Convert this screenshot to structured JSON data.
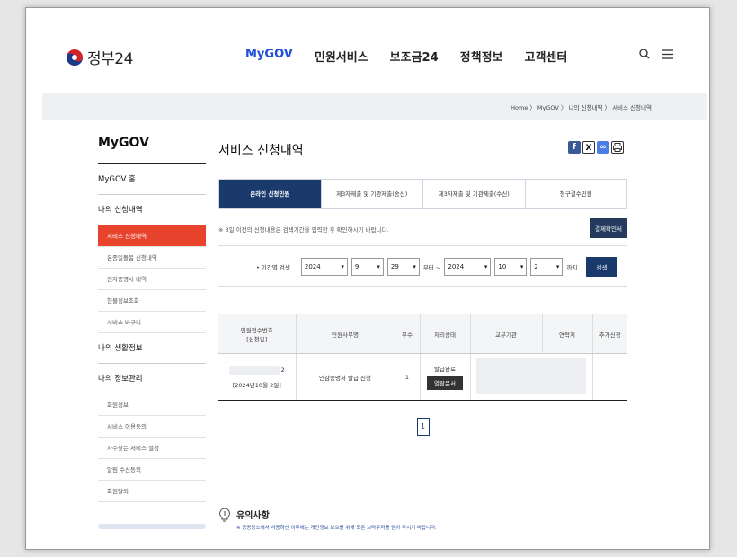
{
  "header": {
    "logo_text": "정부24",
    "nav": [
      "MyGOV",
      "민원서비스",
      "보조금24",
      "정책정보",
      "고객센터"
    ],
    "active_nav": "MyGOV"
  },
  "breadcrumb": "Home 〉 MyGOV 〉 나의 신청내역 〉 서비스 신청내역",
  "sidebar": {
    "title": "MyGOV",
    "home": "MyGOV 홈",
    "section1": "나의 신청내역",
    "sub1": [
      "서비스 신청내역",
      "온종일돌봄 신청내역",
      "전자증명서 내역",
      "현물정보조회",
      "서비스 바구니"
    ],
    "section2": "나의 생활정보",
    "section3": "나의 정보관리",
    "sub3": [
      "회원정보",
      "서비스 이용동의",
      "자주찾는 서비스 설정",
      "알림 수신동의",
      "회원탈퇴"
    ]
  },
  "page": {
    "title": "서비스 신청내역",
    "tabs": [
      "온라인 신청민원",
      "제3자제출 및 기관제출(송신)",
      "제3자제출 및 기관제출(수신)",
      "청구결수민원"
    ],
    "notice": "※ 3일 이전의 신청내용은 검색기간을 입력한 후 확인하시기 바랍니다.",
    "payment_button": "결제확인서",
    "search": {
      "label": "• 기간별 검색",
      "from_year": "2024",
      "from_month": "9",
      "from_day": "29",
      "from_suffix": "부터 ~",
      "to_year": "2024",
      "to_month": "10",
      "to_day": "2",
      "to_suffix": "까지",
      "button": "검색"
    },
    "table": {
      "headers": [
        "민원접수번호\n[신청일]",
        "민원사무명",
        "부수",
        "처리상태",
        "교부기관",
        "연락처",
        "추가신청"
      ],
      "row": {
        "receipt_suffix": "2",
        "date": "[2024년10월 2일]",
        "name": "인감증명서 발급 신청",
        "count": "1",
        "status": "발급완료",
        "doc_button": "열람문서"
      }
    },
    "pager": "1",
    "caution_title": "유의사항",
    "caution_text": "※ 공공장소에서 사용하신 이후에는 개인정보 보호를 위해 모든 브라우저를 닫아 주시기 바랍니다."
  },
  "colors": {
    "navy": "#1a3a6b",
    "active_red": "#e8432c",
    "nav_blue": "#1d4ed8"
  }
}
